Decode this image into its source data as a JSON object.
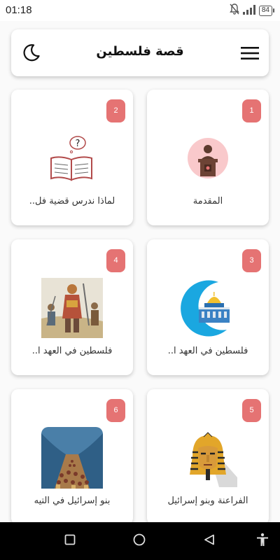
{
  "status": {
    "time": "01:18",
    "battery": "84"
  },
  "appbar": {
    "title": "قصة فلسطين",
    "menu_icon": "hamburger-menu-icon",
    "theme_icon": "moon-icon"
  },
  "accent_color": "#e57373",
  "cards": [
    {
      "number": "1",
      "label": "المقدمة",
      "icon": "speaker-podium-icon"
    },
    {
      "number": "2",
      "label": "لماذا ندرس قضية فل..",
      "icon": "book-question-icon"
    },
    {
      "number": "3",
      "label": "فلسطين في العهد ا..",
      "icon": "dome-of-the-rock-icon"
    },
    {
      "number": "4",
      "label": "فلسطين في العهد ا..",
      "icon": "ancient-warriors-image"
    },
    {
      "number": "5",
      "label": "الفراعنة وبنو إسرائيل",
      "icon": "pharaoh-mask-icon"
    },
    {
      "number": "6",
      "label": "بنو إسرائيل في التيه",
      "icon": "crowd-sea-image"
    }
  ]
}
